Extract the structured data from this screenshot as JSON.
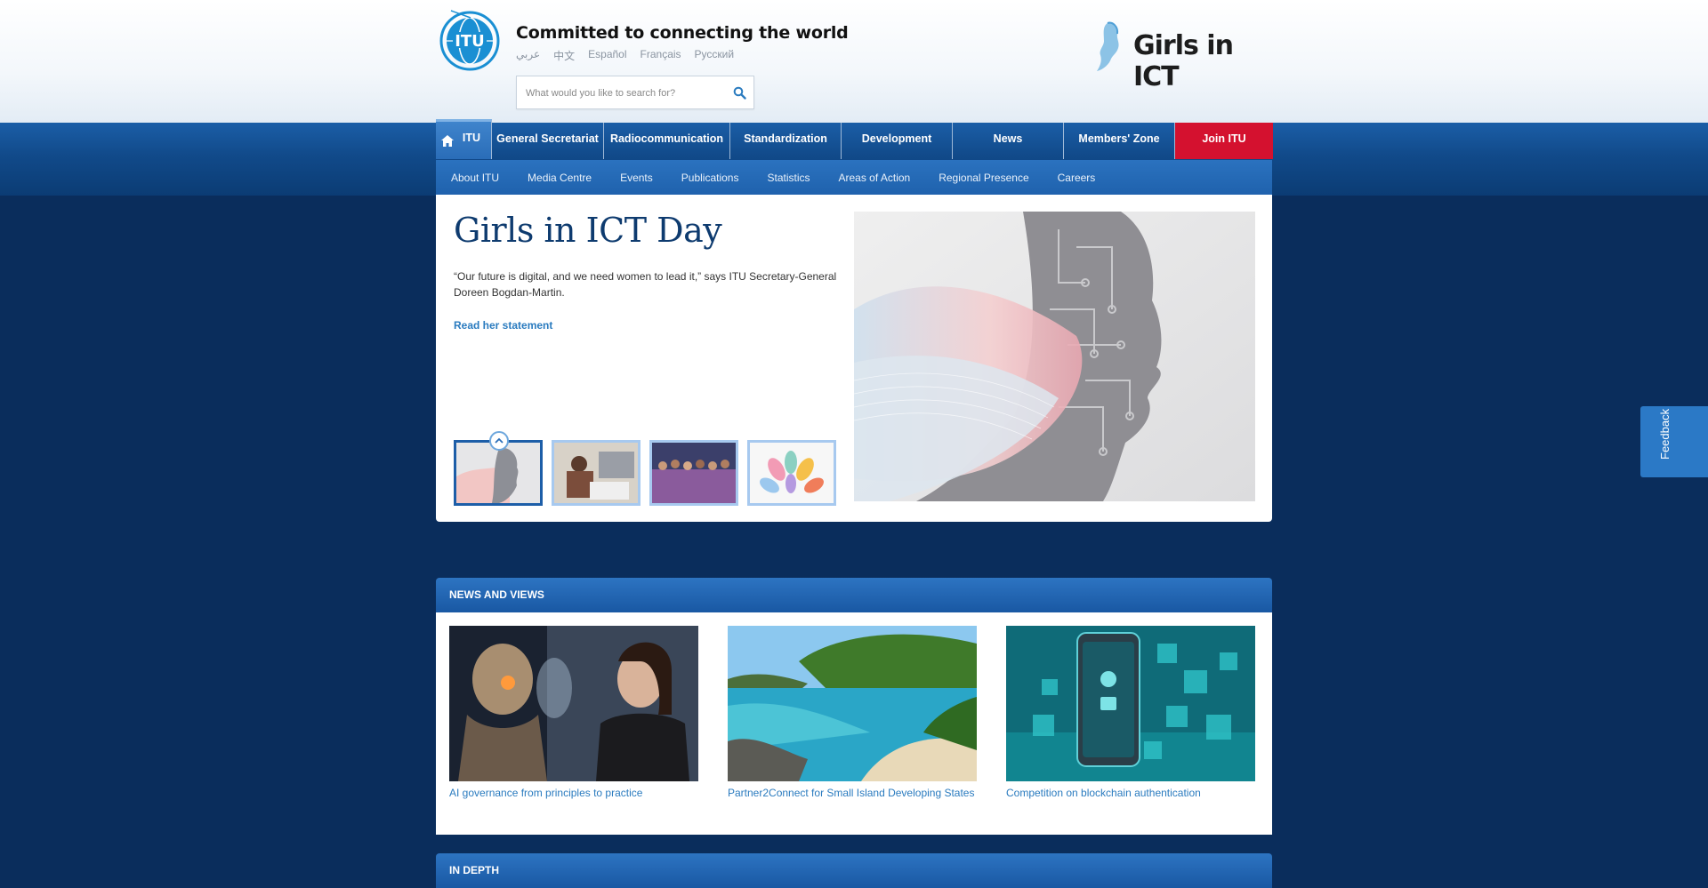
{
  "header": {
    "tagline": "Committed to connecting the world",
    "languages": [
      "عربي",
      "中文",
      "Español",
      "Français",
      "Русский"
    ],
    "search_placeholder": "What would you like to search for?",
    "campaign_logo_text": "Girls in ICT"
  },
  "main_nav": {
    "items": [
      "ITU",
      "General Secretariat",
      "Radiocommunication",
      "Standardization",
      "Development",
      "News",
      "Members' Zone",
      "Join ITU"
    ]
  },
  "sub_nav": {
    "items": [
      "About ITU",
      "Media Centre",
      "Events",
      "Publications",
      "Statistics",
      "Areas of Action",
      "Regional Presence",
      "Careers"
    ]
  },
  "hero": {
    "title": "Girls in ICT Day",
    "quote": "“Our future is digital, and we need women to lead it,” says ITU Secretary-General Doreen Bogdan-Martin.",
    "link": "Read her statement",
    "active_thumb": 1,
    "thumb_count": 4
  },
  "news": {
    "heading": "NEWS AND VIEWS",
    "items": [
      {
        "caption": "AI governance from principles to practice"
      },
      {
        "caption": "Partner2Connect for Small Island Developing States"
      },
      {
        "caption": "Competition on blockchain authentication"
      }
    ]
  },
  "in_depth": {
    "heading": "IN DEPTH"
  },
  "feedback": {
    "label": "Feedback"
  },
  "colors": {
    "page_bg": "#0a2d5c",
    "nav_blue": "#1b5ea7",
    "join_red": "#d4112f",
    "link_blue": "#2a7bbf",
    "title_navy": "#0e3b6f"
  }
}
